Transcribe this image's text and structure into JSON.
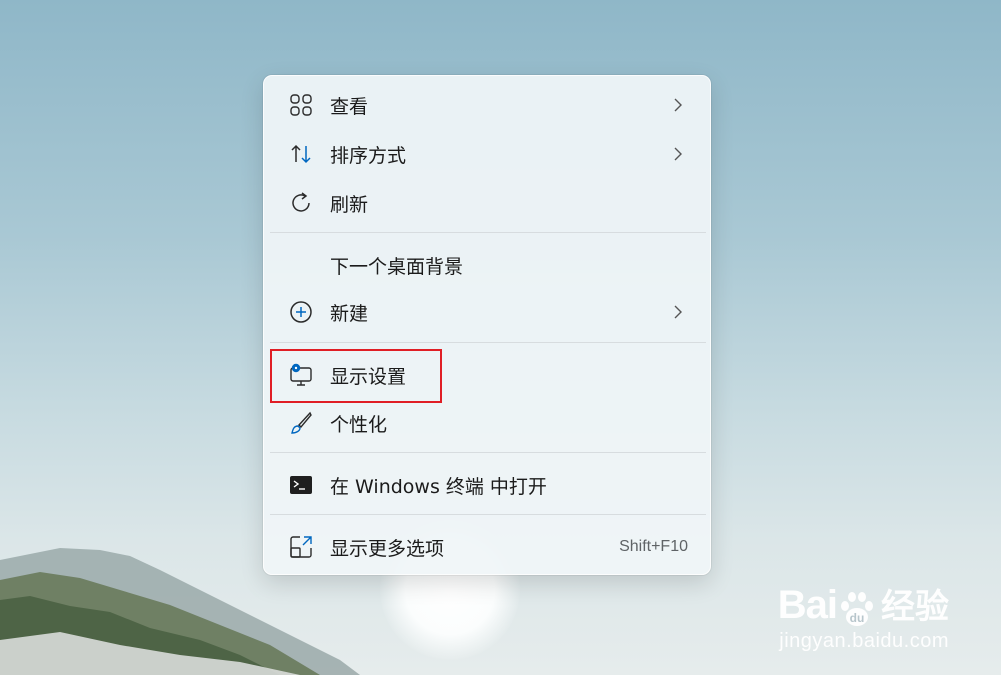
{
  "context_menu": {
    "items": [
      {
        "label": "查看",
        "icon": "view-grid-icon",
        "has_submenu": true
      },
      {
        "label": "排序方式",
        "icon": "sort-icon",
        "has_submenu": true
      },
      {
        "label": "刷新",
        "icon": "refresh-icon",
        "has_submenu": false
      },
      {
        "label": "下一个桌面背景",
        "icon": "",
        "has_submenu": false
      },
      {
        "label": "新建",
        "icon": "new-plus-icon",
        "has_submenu": true
      },
      {
        "label": "显示设置",
        "icon": "display-settings-icon",
        "has_submenu": false,
        "highlighted": true
      },
      {
        "label": "个性化",
        "icon": "personalize-brush-icon",
        "has_submenu": false
      },
      {
        "label": "在 Windows 终端 中打开",
        "icon": "terminal-icon",
        "has_submenu": false
      },
      {
        "label": "显示更多选项",
        "icon": "show-more-options-icon",
        "has_submenu": false,
        "shortcut": "Shift+F10"
      }
    ]
  },
  "watermark": {
    "brand": "Bai",
    "brand_cn": "经验",
    "url": "jingyan.baidu.com"
  },
  "colors": {
    "accent": "#0067c0",
    "highlight_box": "#e01e25"
  }
}
